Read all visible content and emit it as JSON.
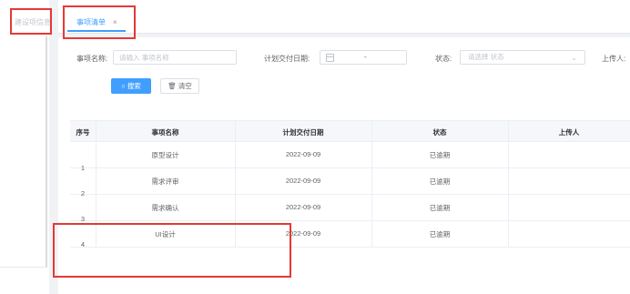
{
  "left": {
    "tab_label": "建设项信息"
  },
  "tab": {
    "label": "事项清单",
    "close": "×"
  },
  "search": {
    "name_label": "事项名称:",
    "name_placeholder": "请输入 事项名称",
    "date_label": "计划交付日期:",
    "date_sep": "-",
    "status_label": "状态:",
    "status_placeholder": "请选择 状态",
    "uploader_label": "上传人:",
    "search_button": "搜索",
    "clear_button": "清空"
  },
  "table": {
    "headers": [
      "序号",
      "事项名称",
      "计划交付日期",
      "状态",
      "上传人"
    ],
    "rows": [
      {
        "index": "1",
        "name": "原型设计",
        "date": "2022-09-09",
        "status": "已逾期",
        "uploader": ""
      },
      {
        "index": "2",
        "name": "需求评审",
        "date": "2022-09-09",
        "status": "已逾期",
        "uploader": ""
      },
      {
        "index": "3",
        "name": "需求确认",
        "date": "2022-09-09",
        "status": "已逾期",
        "uploader": ""
      },
      {
        "index": "4",
        "name": "UI设计",
        "date": "2022-09-09",
        "status": "已逾期",
        "uploader": ""
      }
    ]
  },
  "colors": {
    "accent": "#409eff",
    "highlight": "#e53935"
  }
}
